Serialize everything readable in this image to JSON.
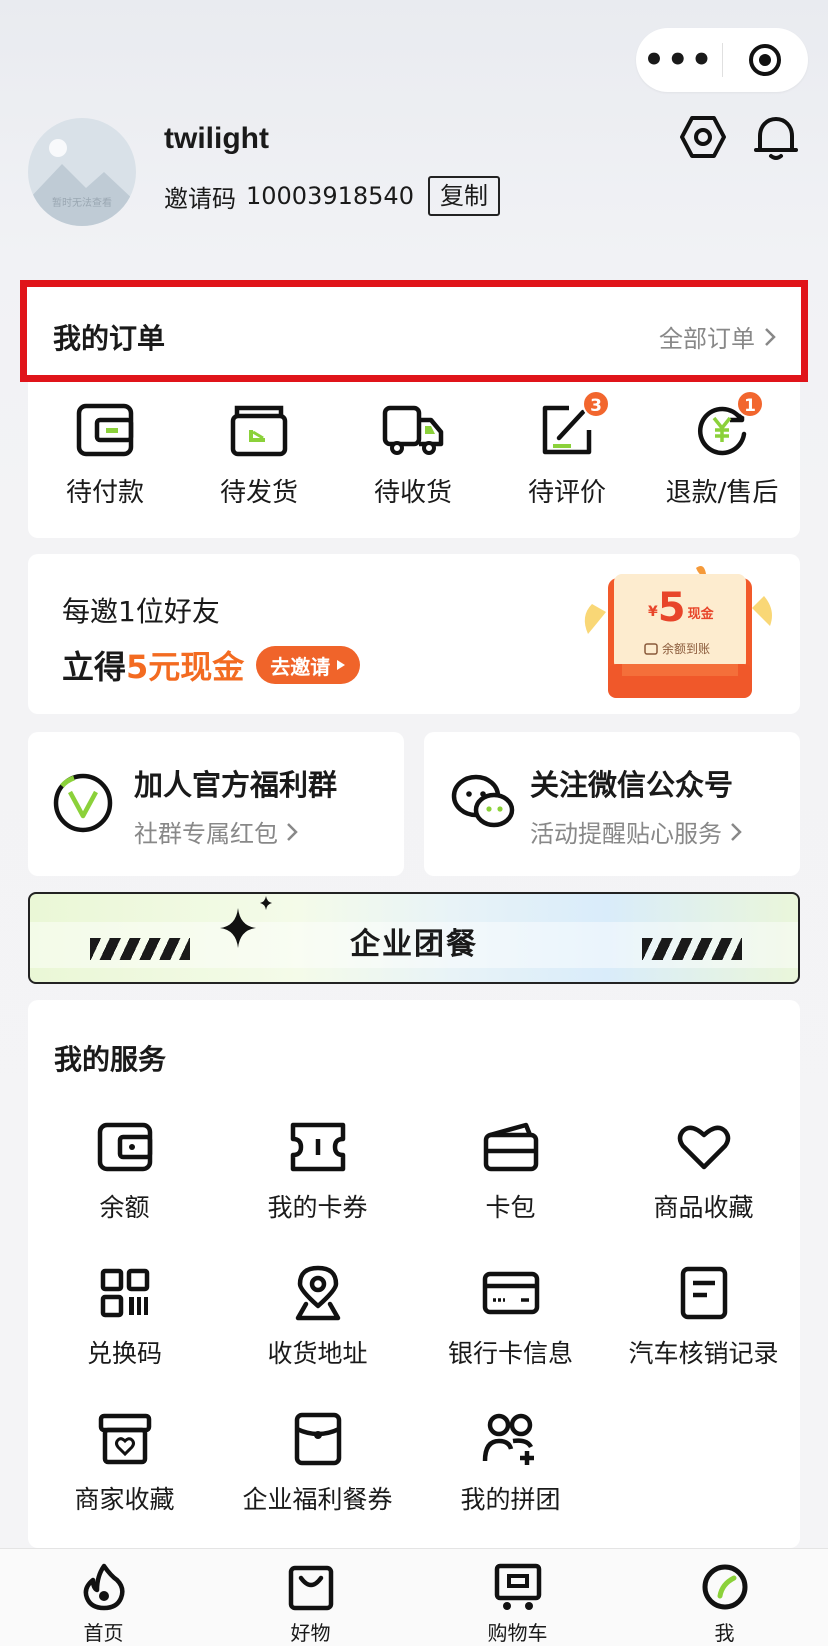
{
  "capsule": {
    "more": "•••",
    "close_icon": "target-icon"
  },
  "profile": {
    "avatar_text": "暂时无法查看",
    "username": "twilight",
    "invite_label": "邀请码",
    "invite_code": "10003918540",
    "copy_label": "复制"
  },
  "orders": {
    "title": "我的订单",
    "all_label": "全部订单",
    "items": [
      {
        "label": "待付款",
        "icon": "wallet-icon",
        "badge": ""
      },
      {
        "label": "待发货",
        "icon": "box-icon",
        "badge": ""
      },
      {
        "label": "待收货",
        "icon": "truck-icon",
        "badge": ""
      },
      {
        "label": "待评价",
        "icon": "edit-icon",
        "badge": "3"
      },
      {
        "label": "退款/售后",
        "icon": "refund-icon",
        "badge": "1"
      }
    ]
  },
  "invite_banner": {
    "line1": "每邀1位好友",
    "line2_prefix": "立得",
    "line2_highlight": "5元现金",
    "button_label": "去邀请",
    "redpack_amount": "5",
    "redpack_unit": "现金",
    "redpack_currency": "¥",
    "redpack_note": "余额到账"
  },
  "group_card": {
    "title": "加人官方福利群",
    "subtitle": "社群专属红包"
  },
  "wechat_card": {
    "title": "关注微信公众号",
    "subtitle": "活动提醒贴心服务"
  },
  "enterprise_banner": {
    "title": "企业团餐"
  },
  "services": {
    "title": "我的服务",
    "rows": [
      [
        {
          "label": "余额",
          "icon": "balance-icon"
        },
        {
          "label": "我的卡券",
          "icon": "ticket-icon"
        },
        {
          "label": "卡包",
          "icon": "card-pack-icon"
        },
        {
          "label": "商品收藏",
          "icon": "heart-icon"
        }
      ],
      [
        {
          "label": "兑换码",
          "icon": "qr-code-icon"
        },
        {
          "label": "收货地址",
          "icon": "location-icon"
        },
        {
          "label": "银行卡信息",
          "icon": "bank-card-icon"
        },
        {
          "label": "汽车核销记录",
          "icon": "record-icon"
        }
      ],
      [
        {
          "label": "商家收藏",
          "icon": "shop-favorite-icon"
        },
        {
          "label": "企业福利餐券",
          "icon": "meal-voucher-icon"
        },
        {
          "label": "我的拼团",
          "icon": "group-buy-icon"
        }
      ]
    ]
  },
  "tabbar": [
    {
      "label": "首页",
      "icon": "home-flame-icon"
    },
    {
      "label": "好物",
      "icon": "shopping-bag-icon"
    },
    {
      "label": "购物车",
      "icon": "cart-icon"
    },
    {
      "label": "我",
      "icon": "profile-ring-icon"
    }
  ],
  "colors": {
    "accent_orange": "#f36b21",
    "highlight_red": "#e0141a",
    "brand_green": "#8bd13a"
  }
}
